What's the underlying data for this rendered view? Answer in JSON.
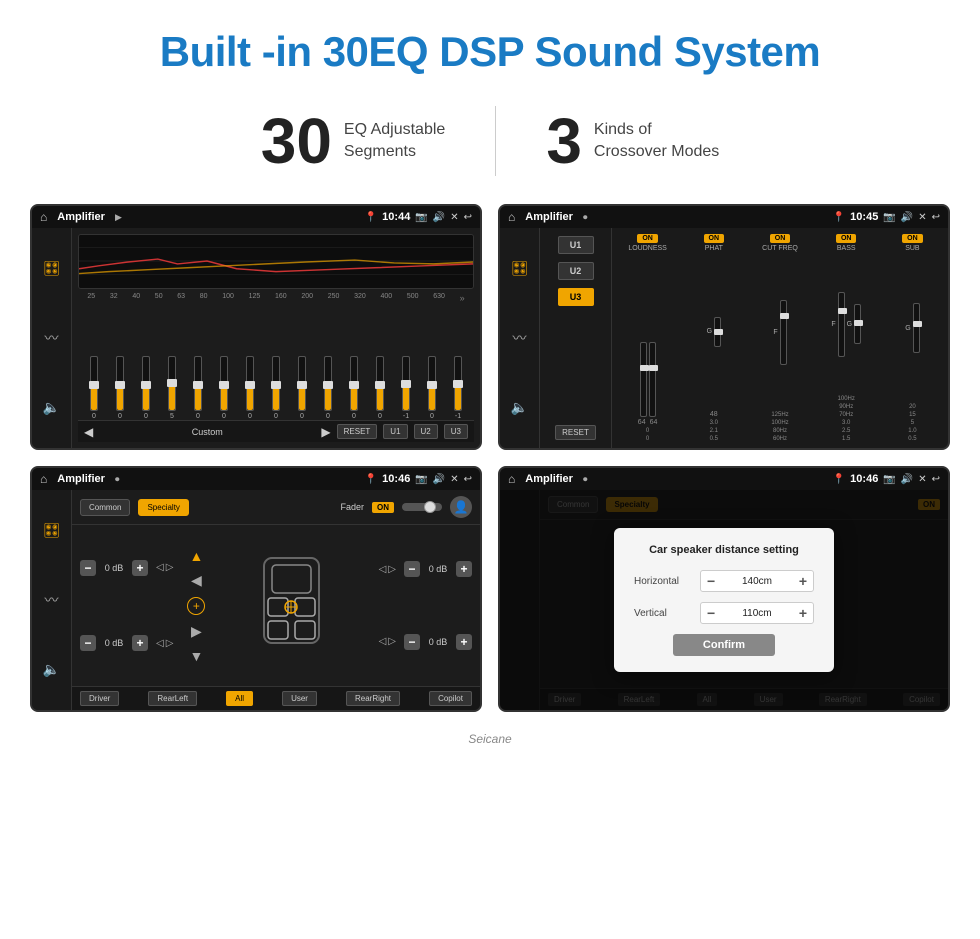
{
  "header": {
    "title": "Built -in 30EQ DSP Sound System"
  },
  "stats": [
    {
      "number": "30",
      "desc_line1": "EQ Adjustable",
      "desc_line2": "Segments"
    },
    {
      "number": "3",
      "desc_line1": "Kinds of",
      "desc_line2": "Crossover Modes"
    }
  ],
  "screen1": {
    "app_name": "Amplifier",
    "time": "10:44",
    "freq_labels": [
      "25",
      "32",
      "40",
      "50",
      "63",
      "80",
      "100",
      "125",
      "160",
      "200",
      "250",
      "320",
      "400",
      "500",
      "630"
    ],
    "slider_values": [
      "0",
      "0",
      "0",
      "0",
      "5",
      "0",
      "0",
      "0",
      "0",
      "0",
      "0",
      "0",
      "0",
      "-1",
      "0",
      "-1"
    ],
    "bottom_buttons": [
      "RESET",
      "U1",
      "U2",
      "U3"
    ],
    "custom_label": "Custom"
  },
  "screen2": {
    "app_name": "Amplifier",
    "time": "10:45",
    "channels": [
      "LOUDNESS",
      "PHAT",
      "CUT FREQ",
      "BASS",
      "SUB"
    ],
    "u_buttons": [
      "U1",
      "U2",
      "U3"
    ],
    "active_u": "U3",
    "reset_label": "RESET"
  },
  "screen3": {
    "app_name": "Amplifier",
    "time": "10:46",
    "mode_buttons": [
      "Common",
      "Specialty"
    ],
    "active_mode": "Specialty",
    "fader_label": "Fader",
    "fader_on": "ON",
    "db_values": [
      "0 dB",
      "0 dB",
      "0 dB",
      "0 dB"
    ],
    "footer_buttons": [
      "Driver",
      "RearLeft",
      "All",
      "User",
      "RearRight",
      "Copilot"
    ],
    "active_footer": "All"
  },
  "screen4": {
    "app_name": "Amplifier",
    "time": "10:46",
    "dialog": {
      "title": "Car speaker distance setting",
      "horizontal_label": "Horizontal",
      "horizontal_value": "140cm",
      "vertical_label": "Vertical",
      "vertical_value": "110cm",
      "confirm_label": "Confirm"
    },
    "footer_buttons": [
      "Driver",
      "RearLeft",
      "All",
      "User",
      "RearRight",
      "Copilot"
    ]
  },
  "watermark": "Seicane"
}
